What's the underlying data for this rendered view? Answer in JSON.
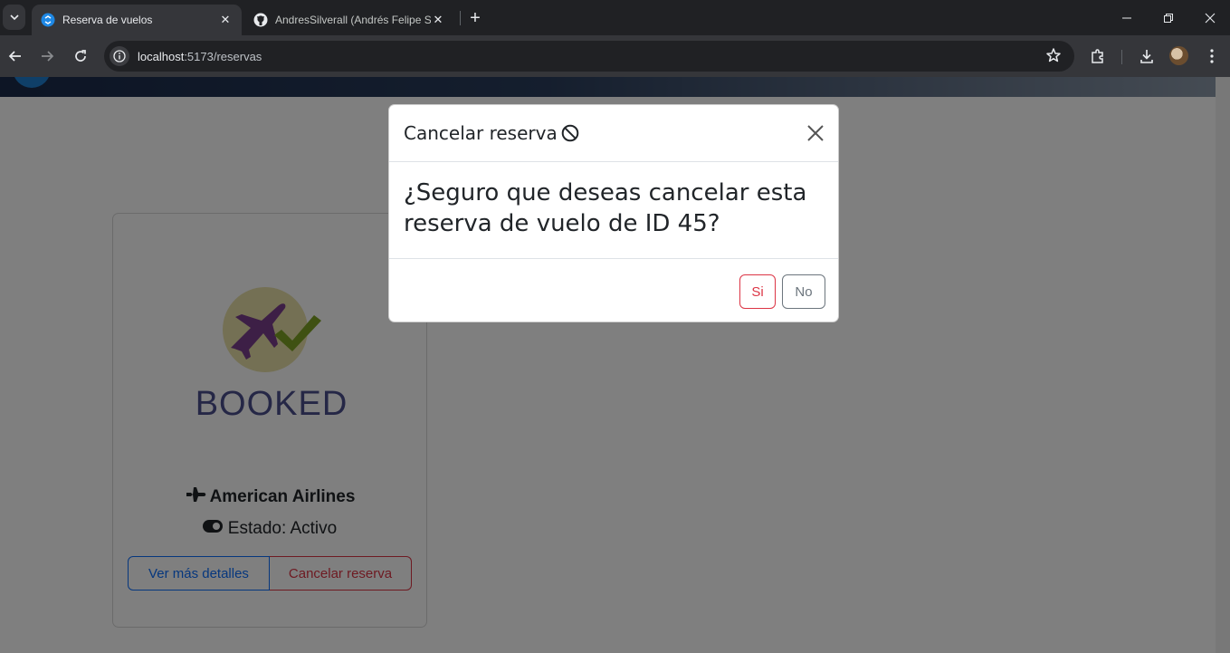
{
  "browser": {
    "tabs": [
      {
        "title": "Reserva de vuelos",
        "active": true,
        "favicon": "blue-globe-icon"
      },
      {
        "title": "AndresSilverall (Andrés Felipe S",
        "active": false,
        "favicon": "github-icon"
      }
    ],
    "url_host": "localhost",
    "url_rest": ":5173/reservas"
  },
  "card": {
    "image_text": "BOOKED",
    "airline": "American Airlines",
    "status": "Estado: Activo",
    "details_button": "Ver más detalles",
    "cancel_button": "Cancelar reserva"
  },
  "modal": {
    "title": "Cancelar reserva",
    "question": "¿Seguro que deseas cancelar esta reserva de vuelo de ID 45?",
    "yes_button": "Si",
    "no_button": "No"
  },
  "colors": {
    "primary": "#0d6efd",
    "danger": "#dc3545",
    "secondary": "#6c757d",
    "booked_text": "#4a4e8c",
    "plane": "#7b3f8c",
    "check": "#7ea324"
  }
}
